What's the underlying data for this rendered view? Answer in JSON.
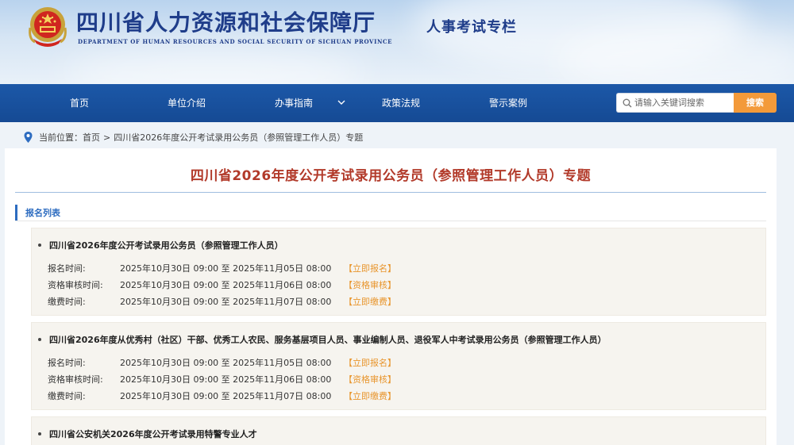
{
  "header": {
    "title": "四川省人力资源和社会保障厅",
    "subtitle": "DEPARTMENT OF HUMAN RESOURCES AND SOCIAL SECURITY OF SICHUAN PROVINCE",
    "column": "人事考试专栏",
    "emblem_icon": "national-emblem-icon"
  },
  "nav": {
    "items": [
      {
        "label": "首页"
      },
      {
        "label": "单位介绍"
      },
      {
        "label": "办事指南",
        "icon": "chevron-down-icon"
      },
      {
        "label": "政策法规"
      },
      {
        "label": "警示案例"
      }
    ],
    "search": {
      "placeholder": "请输入关键词搜索",
      "button": "搜索"
    }
  },
  "breadcrumb": {
    "prefix": "当前位置：",
    "home": "首页",
    "separator": ">",
    "current": "四川省2026年度公开考试录用公务员（参照管理工作人员）专题"
  },
  "page": {
    "title": "四川省2026年度公开考试录用公务员（参照管理工作人员）专题",
    "section": "报名列表"
  },
  "blocks": [
    {
      "title": "四川省2026年度公开考试录用公务员（参照管理工作人员）",
      "rows": [
        {
          "label": "报名时间:",
          "value": "2025年10月30日 09:00 至 2025年11月05日 08:00",
          "action": "【立即报名】"
        },
        {
          "label": "资格审核时间:",
          "value": "2025年10月30日 09:00 至 2025年11月06日 08:00",
          "action": "【资格审核】"
        },
        {
          "label": "缴费时间:",
          "value": "2025年10月30日 09:00 至 2025年11月07日 08:00",
          "action": "【立即缴费】"
        }
      ]
    },
    {
      "title": "四川省2026年度从优秀村（社区）干部、优秀工人农民、服务基层项目人员、事业编制人员、退役军人中考试录用公务员（参照管理工作人员）",
      "rows": [
        {
          "label": "报名时间:",
          "value": "2025年10月30日 09:00 至 2025年11月05日 08:00",
          "action": "【立即报名】"
        },
        {
          "label": "资格审核时间:",
          "value": "2025年10月30日 09:00 至 2025年11月06日 08:00",
          "action": "【资格审核】"
        },
        {
          "label": "缴费时间:",
          "value": "2025年10月30日 09:00 至 2025年11月07日 08:00",
          "action": "【立即缴费】"
        }
      ]
    },
    {
      "title": "四川省公安机关2026年度公开考试录用特警专业人才",
      "rows": []
    }
  ],
  "colors": {
    "nav_bg": "#1a53a0",
    "title_red": "#b23a2a",
    "accent_blue": "#2d6cc0",
    "action_orange": "#e8952c",
    "search_button": "#f39a3a"
  }
}
